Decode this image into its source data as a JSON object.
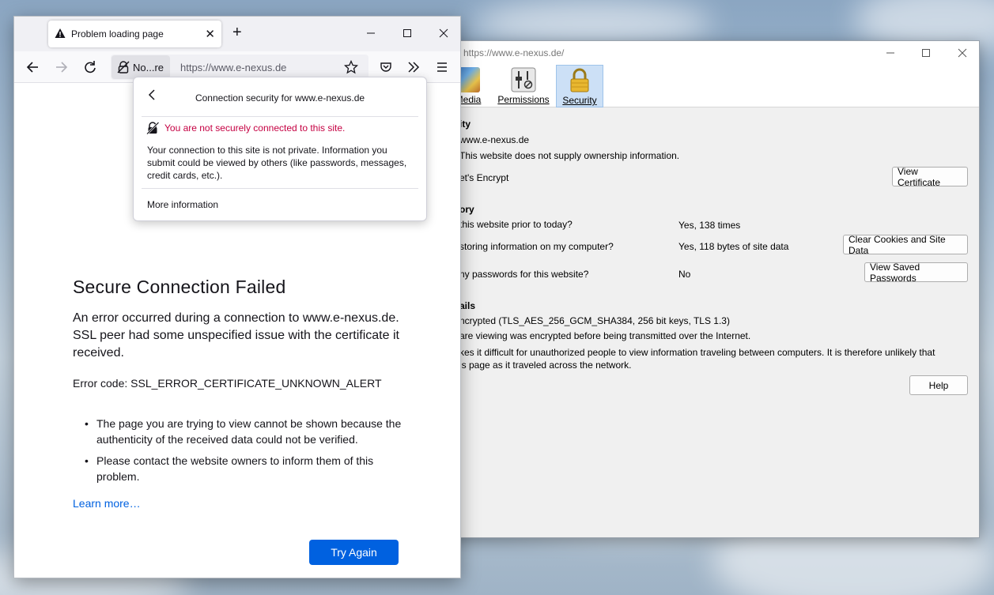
{
  "page_info": {
    "title": "https://www.e-nexus.de/",
    "tabs": [
      {
        "label": "Media"
      },
      {
        "label": "Permissions"
      },
      {
        "label": "Security"
      }
    ],
    "identity": {
      "heading": "ity",
      "website": "www.e-nexus.de",
      "owner": "This website does not supply ownership information.",
      "verifier": "et's Encrypt",
      "view_certificate": "View Certificate"
    },
    "history": {
      "heading": "ory",
      "visited_q": "this website prior to today?",
      "visited_a": "Yes, 138 times",
      "storing_q": "storing information on my computer?",
      "storing_a": "Yes, 118 bytes of site data",
      "clear_button": "Clear Cookies and Site Data",
      "passwords_q": "ny passwords for this website?",
      "passwords_a": "No",
      "view_passwords": "View Saved Passwords"
    },
    "technical": {
      "heading": "ails",
      "encryption": "ncrypted (TLS_AES_256_GCM_SHA384, 256 bit keys, TLS 1.3)",
      "line2": "are viewing was encrypted before being transmitted over the Internet.",
      "line3": "kes it difficult for unauthorized people to view information traveling between computers. It is therefore unlikely that",
      "line4": "is page as it traveled across the network."
    },
    "help": "Help"
  },
  "browser": {
    "tab_title": "Problem loading page",
    "identity_label": "No...re",
    "url": "https://www.e-nexus.de",
    "error": {
      "title": "Secure Connection Failed",
      "description": "An error occurred during a connection to www.e-nexus.de. SSL peer had some unspecified issue with the certificate it received.",
      "code": "Error code: SSL_ERROR_CERTIFICATE_UNKNOWN_ALERT",
      "bullets": [
        "The page you are trying to view cannot be shown because the authenticity of the received data could not be verified.",
        "Please contact the website owners to inform them of this problem."
      ],
      "learn_more": "Learn more…",
      "try_again": "Try Again"
    }
  },
  "popup": {
    "title": "Connection security for www.e-nexus.de",
    "warning": "You are not securely connected to this site.",
    "body": "Your connection to this site is not private. Information you submit could be viewed by others (like passwords, messages, credit cards, etc.).",
    "more": "More information"
  },
  "colors": {
    "accent": "#0061e0",
    "warning_text": "#c50042",
    "selected_tab": "#cce0f6"
  }
}
